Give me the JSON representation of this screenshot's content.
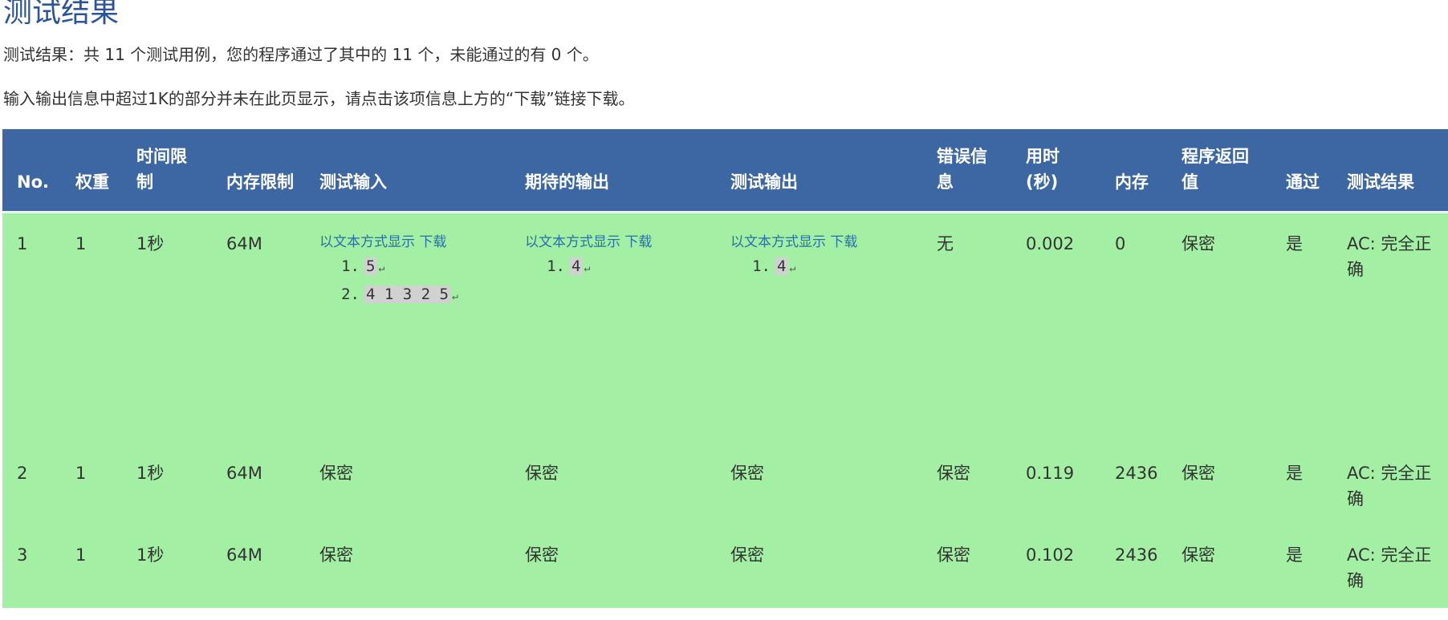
{
  "page": {
    "title": "测试结果",
    "summary": "测试结果：共 11 个测试用例，您的程序通过了其中的 11 个，未能通过的有 0 个。",
    "notice": "输入输出信息中超过1K的部分并未在此页显示，请点击该项信息上方的“下载”链接下载。"
  },
  "table": {
    "headers": [
      "No.",
      "权重",
      "时间限制",
      "内存限制",
      "测试输入",
      "期待的输出",
      "测试输出",
      "错误信息",
      "用时(秒)",
      "内存",
      "程序返回值",
      "通过",
      "测试结果"
    ],
    "io_links": {
      "show_text": "以文本方式显示",
      "download": "下载"
    },
    "rows": [
      {
        "no": "1",
        "weight": "1",
        "time_limit": "1秒",
        "mem_limit": "64M",
        "input": [
          "5",
          "4 1 3 2 5"
        ],
        "expected": [
          "4"
        ],
        "output": [
          "4"
        ],
        "error": "无",
        "time": "0.002",
        "memory": "0",
        "return_value": "保密",
        "passed": "是",
        "result": "AC: 完全正确"
      },
      {
        "no": "2",
        "weight": "1",
        "time_limit": "1秒",
        "mem_limit": "64M",
        "input": "保密",
        "expected": "保密",
        "output": "保密",
        "error": "保密",
        "time": "0.119",
        "memory": "2436",
        "return_value": "保密",
        "passed": "是",
        "result": "AC: 完全正确"
      },
      {
        "no": "3",
        "weight": "1",
        "time_limit": "1秒",
        "mem_limit": "64M",
        "input": "保密",
        "expected": "保密",
        "output": "保密",
        "error": "保密",
        "time": "0.102",
        "memory": "2436",
        "return_value": "保密",
        "passed": "是",
        "result": "AC: 完全正确"
      }
    ]
  },
  "line_numbers": [
    "1.",
    "2."
  ],
  "return_glyph": "↵",
  "colors": {
    "title": "#2a5596",
    "header_bg": "#3d67a2",
    "row_bg": "#a3efa3",
    "link": "#2a6fa8"
  }
}
